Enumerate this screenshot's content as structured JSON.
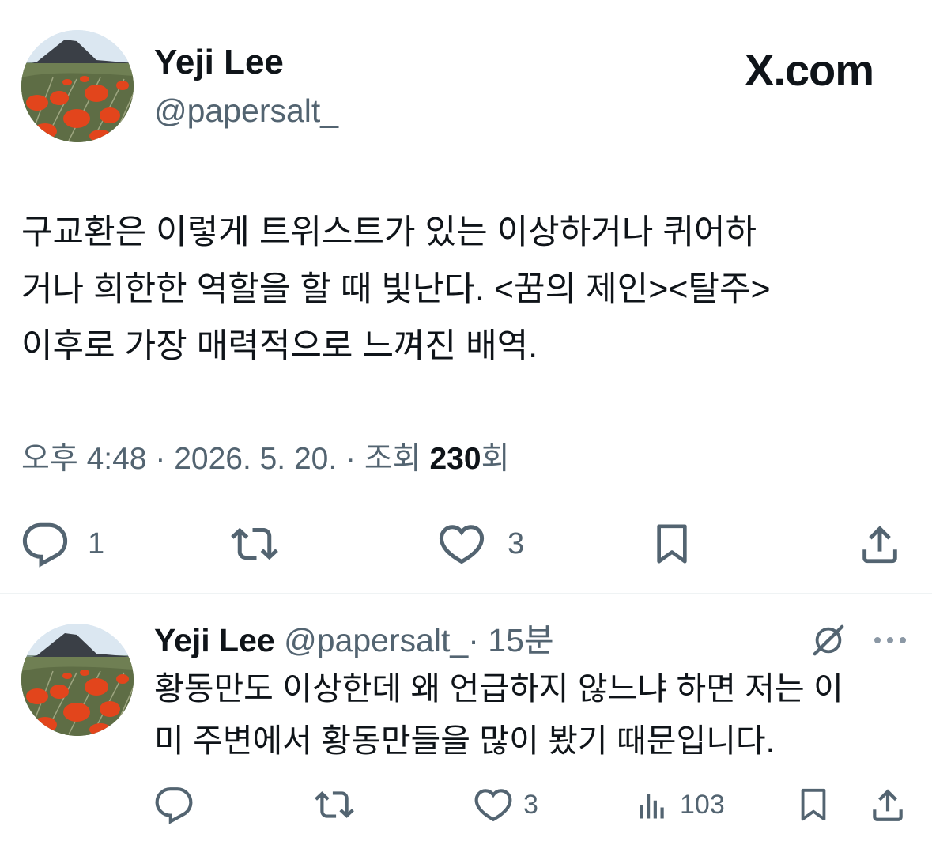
{
  "brand": {
    "logo_text": "X.com"
  },
  "main_tweet": {
    "author": {
      "name": "Yeji Lee",
      "handle": "@papersalt_"
    },
    "text_lines": [
      "구교환은 이렇게 트위스트가 있는 이상하거나 퀴어하",
      "거나 희한한 역할을 할 때 빛난다. <꿈의 제인><탈주>",
      "이후로 가장 매력적으로 느껴진 배역."
    ],
    "meta": {
      "time": "오후 4:48",
      "sep1": " · ",
      "date": "2026. 5. 20.",
      "sep2": " · ",
      "views_prefix": "조회 ",
      "views_count": "230",
      "views_suffix": "회"
    },
    "actions": {
      "replies": "1",
      "likes": "3"
    }
  },
  "reply_tweet": {
    "author": {
      "name": "Yeji Lee",
      "handle": "@papersalt_"
    },
    "time": "· 15분",
    "text_lines": [
      "황동만도 이상한데 왜 언급하지 않느냐 하면 저는 이",
      "미 주변에서 황동만들을 많이 봤기 때문입니다."
    ],
    "actions": {
      "likes": "3",
      "views": "103"
    }
  },
  "icons": [
    "reply-icon",
    "retweet-icon",
    "like-icon",
    "bookmark-icon",
    "share-icon",
    "grok-icon",
    "more-icon",
    "views-icon"
  ],
  "colors": {
    "text": "#0f1419",
    "muted": "#536471",
    "divider": "#eff3f4",
    "poppy": "#e2451c"
  }
}
